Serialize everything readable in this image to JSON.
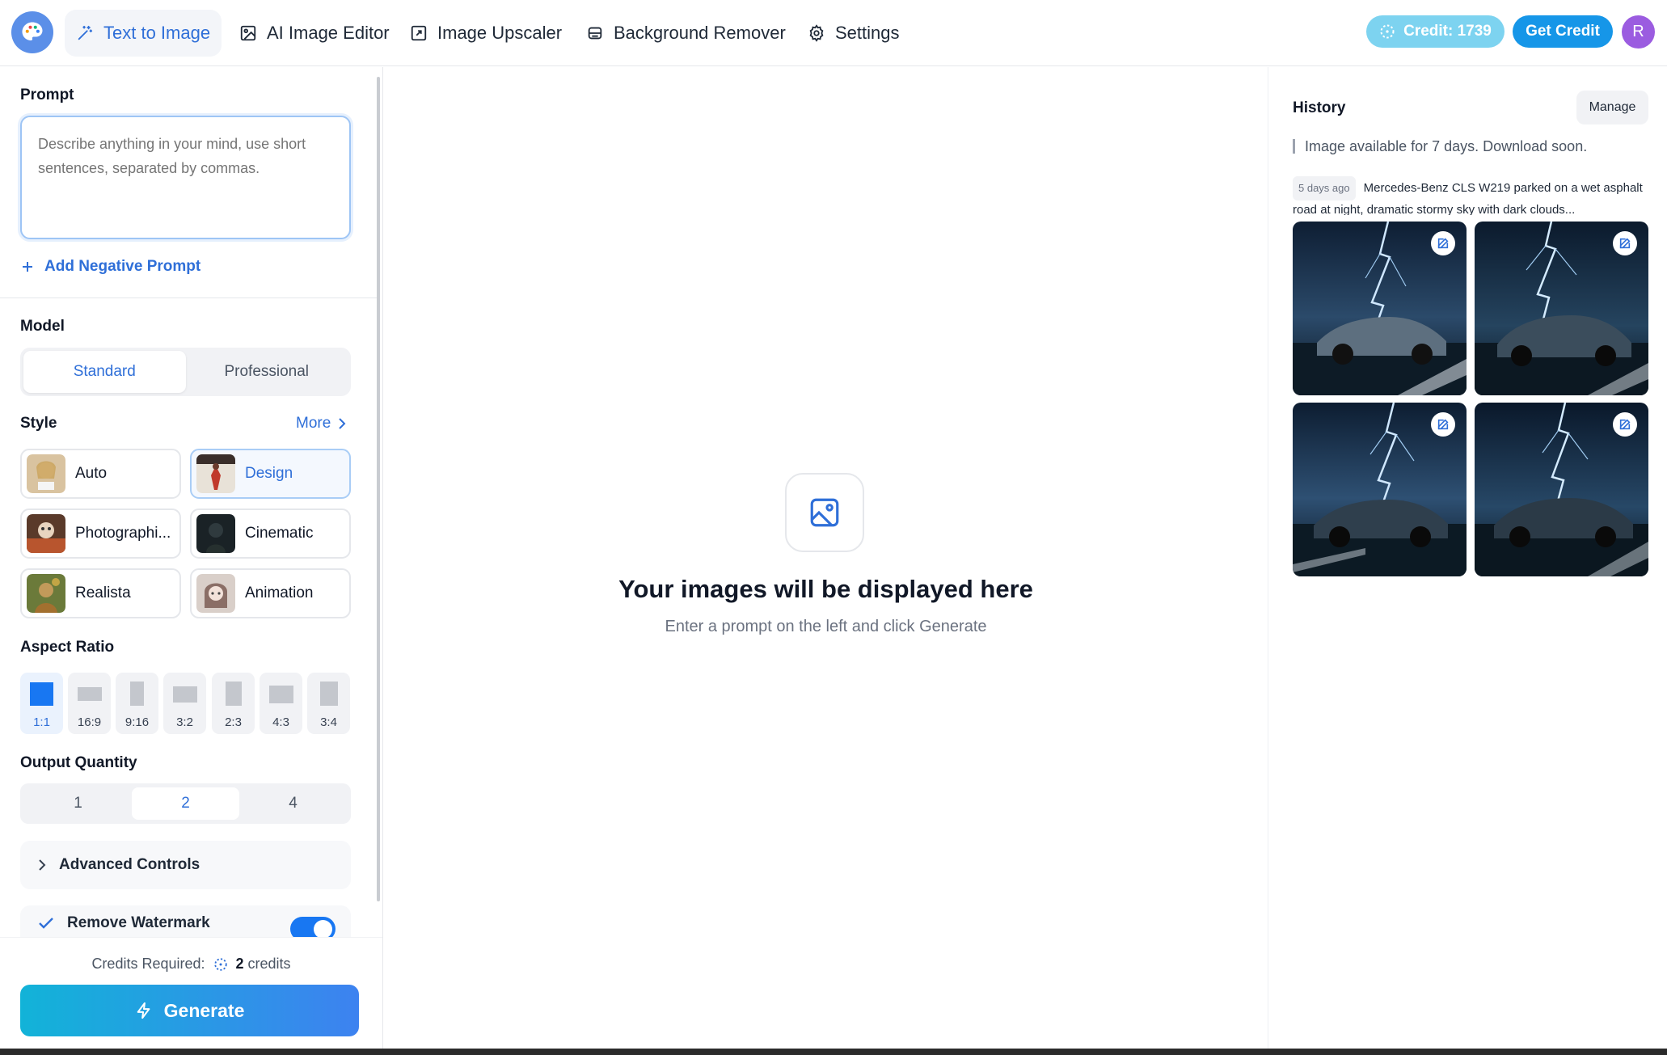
{
  "nav": {
    "items": [
      {
        "label": "Text to Image",
        "icon": "magic-wand-icon",
        "active": true
      },
      {
        "label": "AI Image Editor",
        "icon": "image-edit-icon",
        "active": false
      },
      {
        "label": "Image Upscaler",
        "icon": "upscale-icon",
        "active": false
      },
      {
        "label": "Background Remover",
        "icon": "eraser-icon",
        "active": false
      },
      {
        "label": "Settings",
        "icon": "gear-icon",
        "active": false
      }
    ],
    "credit_label": "Credit: 1739",
    "get_credit_label": "Get Credit",
    "avatar_initial": "R"
  },
  "left": {
    "prompt_label": "Prompt",
    "prompt_placeholder": "Describe anything in your mind, use short sentences, separated by commas.",
    "negative_prompt_label": "Add Negative Prompt",
    "model_label": "Model",
    "models": [
      {
        "label": "Standard",
        "selected": true
      },
      {
        "label": "Professional",
        "selected": false
      }
    ],
    "style_label": "Style",
    "style_more": "More",
    "styles": [
      {
        "label": "Auto",
        "selected": false
      },
      {
        "label": "Design",
        "selected": true
      },
      {
        "label": "Photographi...",
        "selected": false
      },
      {
        "label": "Cinematic",
        "selected": false
      },
      {
        "label": "Realista",
        "selected": false
      },
      {
        "label": "Animation",
        "selected": false
      }
    ],
    "aspect_label": "Aspect Ratio",
    "aspect_ratios": [
      {
        "label": "1:1",
        "selected": true
      },
      {
        "label": "16:9",
        "selected": false
      },
      {
        "label": "9:16",
        "selected": false
      },
      {
        "label": "3:2",
        "selected": false
      },
      {
        "label": "2:3",
        "selected": false
      },
      {
        "label": "4:3",
        "selected": false
      },
      {
        "label": "3:4",
        "selected": false
      }
    ],
    "quantity_label": "Output Quantity",
    "quantities": [
      {
        "label": "1",
        "selected": false
      },
      {
        "label": "2",
        "selected": true
      },
      {
        "label": "4",
        "selected": false
      }
    ],
    "advanced_label": "Advanced Controls",
    "watermark_label": "Remove Watermark",
    "watermark_enabled": true,
    "credits_required_label": "Credits Required:",
    "credits_required_value": "2",
    "credits_unit": "credits",
    "generate_label": "Generate"
  },
  "center": {
    "empty_title": "Your images will be displayed here",
    "empty_subtitle": "Enter a prompt on the left and click Generate"
  },
  "history": {
    "title": "History",
    "manage_label": "Manage",
    "notice": "Image available for 7 days. Download soon.",
    "entries": [
      {
        "time": "5 days ago",
        "prompt": "Mercedes-Benz CLS W219 parked on a wet asphalt road at night, dramatic stormy sky with dark clouds...",
        "image_count": 4
      }
    ]
  },
  "colors": {
    "accent": "#2f6fd8",
    "primary_blue": "#1877f2",
    "credit_pill": "#7dd3f0",
    "get_credit": "#1696e8",
    "avatar": "#9b5ce0",
    "generate_gradient_start": "#12b3d8",
    "generate_gradient_end": "#3d82f0"
  }
}
